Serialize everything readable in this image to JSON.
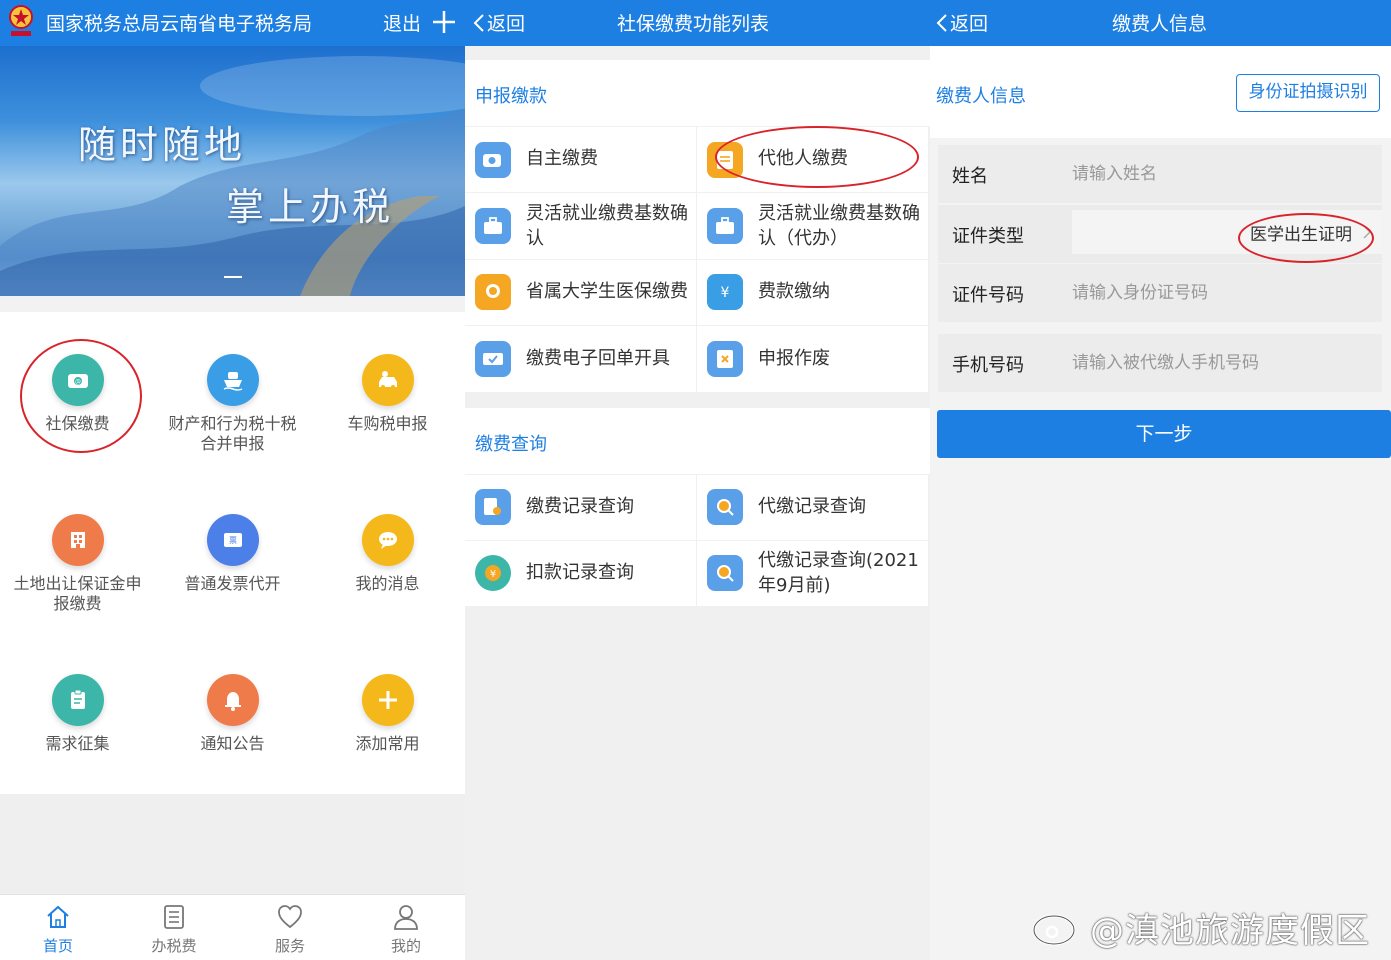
{
  "panel1": {
    "app_title": "国家税务总局云南省电子税务局",
    "logout": "退出",
    "banner_line1": "随时随地",
    "banner_line2": "掌上办税",
    "grid": [
      {
        "label": "社保缴费",
        "icon": "wallet-icon",
        "color": "#3bb6a8"
      },
      {
        "label": "财产和行为税十税合并申报",
        "icon": "ship-icon",
        "color": "#3a9ee6"
      },
      {
        "label": "车购税申报",
        "icon": "car-icon",
        "color": "#f5b81a"
      },
      {
        "label": "土地出让保证金申报缴费",
        "icon": "building-icon",
        "color": "#ef7b4a"
      },
      {
        "label": "普通发票代开",
        "icon": "invoice-icon",
        "color": "#4d7fe8"
      },
      {
        "label": "我的消息",
        "icon": "chat-icon",
        "color": "#f5b81a"
      },
      {
        "label": "需求征集",
        "icon": "clipboard-icon",
        "color": "#3bb6a8"
      },
      {
        "label": "通知公告",
        "icon": "bell-icon",
        "color": "#ef7b4a"
      },
      {
        "label": "添加常用",
        "icon": "add-icon",
        "color": "#f5b81a"
      }
    ],
    "tabs": [
      "首页",
      "办税费",
      "服务",
      "我的"
    ],
    "accent": "#1e7fe3"
  },
  "panel2": {
    "back": "返回",
    "title": "社保缴费功能列表",
    "section1": "申报缴款",
    "section1_items": [
      "自主缴费",
      "代他人缴费",
      "灵活就业缴费基数确认",
      "灵活就业缴费基数确认（代办）",
      "省属大学生医保缴费",
      "费款缴纳",
      "缴费电子回单开具",
      "申报作废"
    ],
    "section2": "缴费查询",
    "section2_items": [
      "缴费记录查询",
      "代缴记录查询",
      "扣款记录查询",
      "代缴记录查询(2021年9月前)"
    ]
  },
  "panel3": {
    "back": "返回",
    "title": "缴费人信息",
    "section": "缴费人信息",
    "id_scan_button": "身份证拍摄识别",
    "fields": {
      "name_label": "姓名",
      "name_placeholder": "请输入姓名",
      "idtype_label": "证件类型",
      "idtype_value": "医学出生证明",
      "idno_label": "证件号码",
      "idno_placeholder": "请输入身份证号码",
      "phone_label": "手机号码",
      "phone_placeholder": "请输入被代缴人手机号码"
    },
    "next_button": "下一步",
    "watermark": "@滇池旅游度假区"
  }
}
